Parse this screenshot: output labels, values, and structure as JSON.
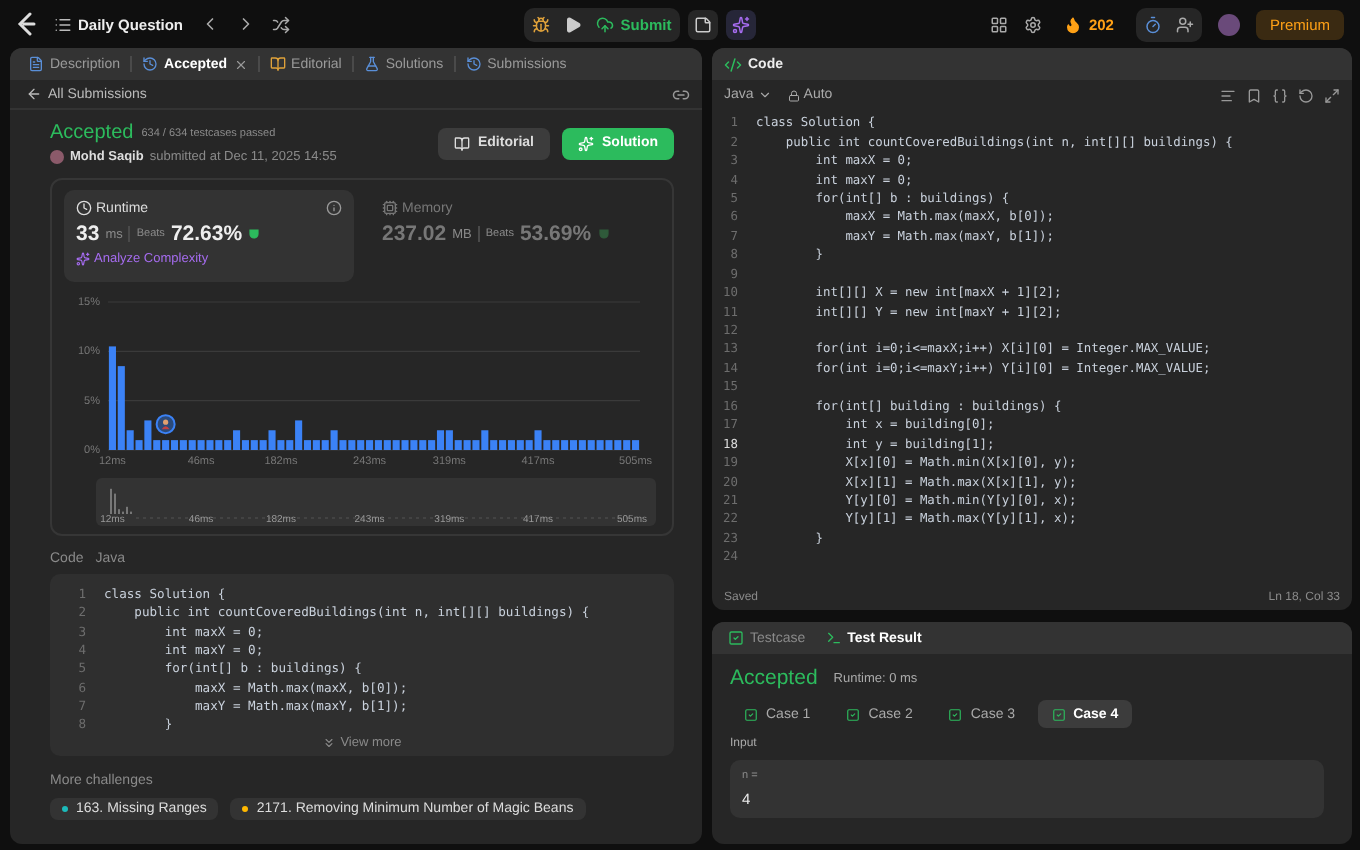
{
  "top_bar": {
    "title": "Daily Question",
    "submit": "Submit",
    "streak": "202",
    "premium": "Premium"
  },
  "left_panel": {
    "tabs": [
      {
        "label": "Description",
        "kind": "description",
        "selected": false,
        "closable": false
      },
      {
        "label": "Accepted",
        "kind": "accepted",
        "selected": true,
        "closable": true
      },
      {
        "label": "Editorial",
        "kind": "editorial",
        "selected": false,
        "closable": false
      },
      {
        "label": "Solutions",
        "kind": "solutions",
        "selected": false,
        "closable": false
      },
      {
        "label": "Submissions",
        "kind": "submissions",
        "selected": false,
        "closable": false
      }
    ],
    "back_link": "All Submissions",
    "result": {
      "status": "Accepted",
      "testcases": "634 / 634 testcases passed",
      "author": "Mohd Saqib",
      "submitted": "submitted at Dec 11, 2025 14:55"
    },
    "buttons": [
      {
        "label": "Editorial",
        "kind": "editorial"
      },
      {
        "label": "Solution",
        "kind": "solution"
      }
    ],
    "metrics": [
      {
        "label": "Runtime",
        "kind": "runtime",
        "value": "33",
        "unit": "ms",
        "beats_label": "Beats",
        "beats": "72.63%",
        "selected": true,
        "link": "Analyze Complexity"
      },
      {
        "label": "Memory",
        "kind": "memory",
        "value": "237.02",
        "unit": "MB",
        "beats_label": "Beats",
        "beats": "53.69%",
        "selected": false
      }
    ],
    "chart": {
      "chart_data": {
        "type": "bar",
        "categories": [
          "12ms",
          null,
          null,
          null,
          null,
          null,
          null,
          null,
          null,
          null,
          "46ms",
          null,
          null,
          null,
          null,
          null,
          null,
          null,
          null,
          "182ms",
          null,
          null,
          null,
          null,
          null,
          null,
          null,
          null,
          null,
          "243ms",
          null,
          null,
          null,
          null,
          null,
          null,
          null,
          null,
          "319ms",
          null,
          null,
          null,
          null,
          null,
          null,
          null,
          null,
          null,
          "417ms",
          null,
          null,
          null,
          null,
          null,
          null,
          null,
          null,
          null,
          null,
          "505ms"
        ],
        "values": [
          10.5,
          8.5,
          2,
          1,
          3,
          1,
          1,
          1,
          1,
          1,
          1,
          1,
          1,
          1,
          2,
          1,
          1,
          1,
          2,
          1,
          1,
          3,
          1,
          1,
          1,
          2,
          1,
          1,
          1,
          1,
          1,
          1,
          1,
          1,
          1,
          1,
          1,
          2,
          2,
          1,
          1,
          1,
          2,
          1,
          1,
          1,
          1,
          1,
          2,
          1,
          1,
          1,
          1,
          1,
          1,
          1,
          1,
          1,
          1,
          1
        ],
        "ylim": [
          0,
          15
        ],
        "yticks": [
          {
            "value": 0,
            "label": "0%"
          },
          {
            "value": 5,
            "label": "5%"
          },
          {
            "value": 10,
            "label": "10%"
          },
          {
            "value": 15,
            "label": "15%"
          }
        ]
      },
      "range_labels": [
        "12ms",
        "46ms",
        "182ms",
        "243ms",
        "319ms",
        "417ms",
        "505ms"
      ]
    },
    "code_label": "Code",
    "code_language": "Java",
    "code": [
      "class Solution {",
      "    public int countCoveredBuildings(int n, int[][] buildings) {",
      "        int maxX = 0;",
      "        int maxY = 0;",
      "        for(int[] b : buildings) {",
      "            maxX = Math.max(maxX, b[0]);",
      "            maxY = Math.max(maxY, b[1]);",
      "        }"
    ],
    "code_numbers": [
      "1",
      "2",
      "3",
      "4",
      "5",
      "6",
      "7",
      "8"
    ],
    "view_more": "View more",
    "more_title": "More challenges",
    "challenges": [
      {
        "label": "163. Missing Ranges",
        "color": "#1cbaba"
      },
      {
        "label": "2171. Removing Minimum Number of Magic Beans",
        "color": "#ffb800"
      }
    ]
  },
  "code_panel": {
    "title": "Code",
    "language": "Java",
    "mode": "Auto",
    "lines": [
      {
        "number": "1",
        "code": "class Solution {",
        "current": false
      },
      {
        "number": "2",
        "code": "    public int countCoveredBuildings(int n, int[][] buildings) {",
        "current": false
      },
      {
        "number": "3",
        "code": "        int maxX = 0;",
        "current": false
      },
      {
        "number": "4",
        "code": "        int maxY = 0;",
        "current": false
      },
      {
        "number": "5",
        "code": "        for(int[] b : buildings) {",
        "current": false
      },
      {
        "number": "6",
        "code": "            maxX = Math.max(maxX, b[0]);",
        "current": false
      },
      {
        "number": "7",
        "code": "            maxY = Math.max(maxY, b[1]);",
        "current": false
      },
      {
        "number": "8",
        "code": "        }",
        "current": false
      },
      {
        "number": "9",
        "current": false
      },
      {
        "number": "10",
        "code": "        int[][] X = new int[maxX + 1][2];",
        "current": false
      },
      {
        "number": "11",
        "code": "        int[][] Y = new int[maxY + 1][2];",
        "current": false
      },
      {
        "number": "12",
        "current": false
      },
      {
        "number": "13",
        "code": "        for(int i=0;i<=maxX;i++) X[i][0] = Integer.MAX_VALUE;",
        "current": false
      },
      {
        "number": "14",
        "code": "        for(int i=0;i<=maxY;i++) Y[i][0] = Integer.MAX_VALUE;",
        "current": false
      },
      {
        "number": "15",
        "current": false
      },
      {
        "number": "16",
        "code": "        for(int[] building : buildings) {",
        "current": false
      },
      {
        "number": "17",
        "code": "            int x = building[0];",
        "current": false
      },
      {
        "number": "18",
        "code": "            int y = building[1];",
        "current": true
      },
      {
        "number": "19",
        "code": "            X[x][0] = Math.min(X[x][0], y);",
        "current": false
      },
      {
        "number": "20",
        "code": "            X[x][1] = Math.max(X[x][1], y);",
        "current": false
      },
      {
        "number": "21",
        "code": "            Y[y][0] = Math.min(Y[y][0], x);",
        "current": false
      },
      {
        "number": "22",
        "code": "            Y[y][1] = Math.max(Y[y][1], x);",
        "current": false
      },
      {
        "number": "23",
        "code": "        }",
        "current": false
      },
      {
        "number": "24",
        "current": false
      }
    ],
    "status": "Saved",
    "cursor": "Ln 18, Col 33"
  },
  "test_panel": {
    "tabs": [
      {
        "label": "Testcase",
        "kind": "testcase",
        "selected": false
      },
      {
        "label": "Test Result",
        "kind": "result",
        "selected": true
      }
    ],
    "status": "Accepted",
    "runtime": "Runtime: 0 ms",
    "cases": [
      {
        "label": "Case 1",
        "passed": true,
        "selected": false
      },
      {
        "label": "Case 2",
        "passed": true,
        "selected": false
      },
      {
        "label": "Case 3",
        "passed": true,
        "selected": false
      },
      {
        "label": "Case 4",
        "passed": true,
        "selected": true
      }
    ],
    "input_label": "Input",
    "param": "n =",
    "value": "4"
  }
}
